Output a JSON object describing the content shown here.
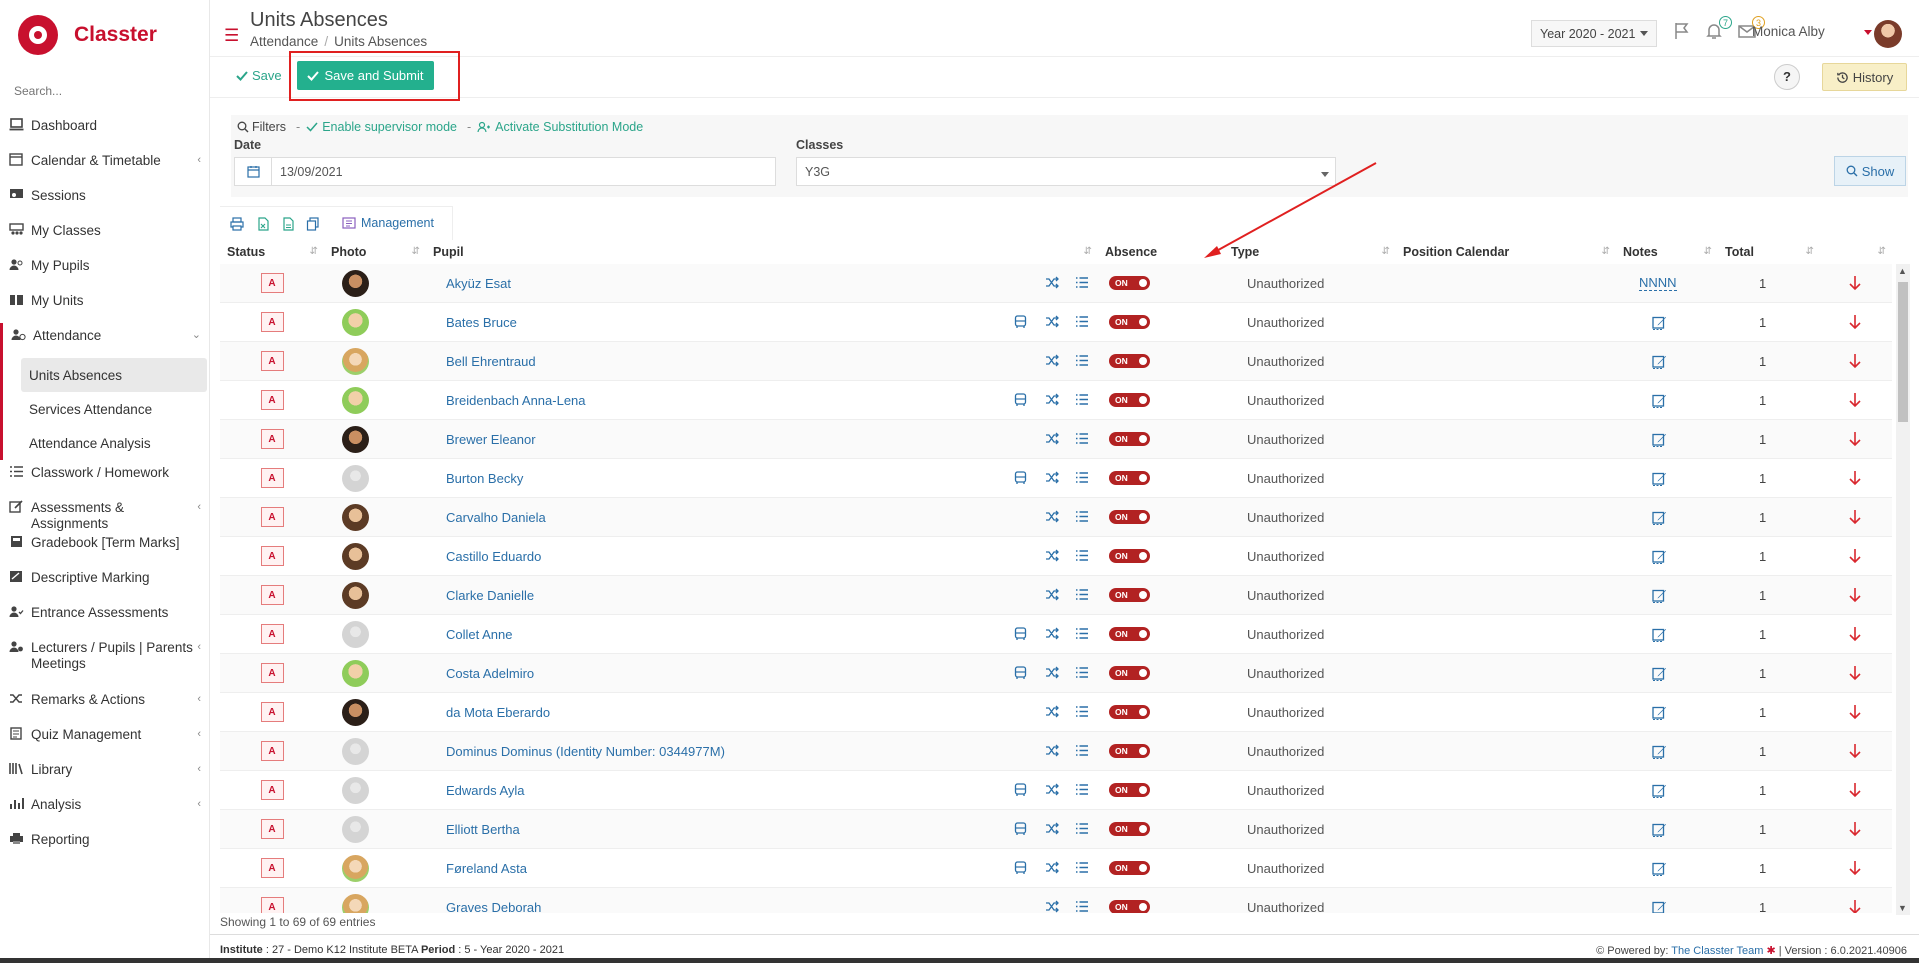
{
  "app": {
    "name": "Classter"
  },
  "sidebar": {
    "search_placeholder": "Search...",
    "items": [
      {
        "label": "Dashboard",
        "icon": "laptop-icon"
      },
      {
        "label": "Calendar & Timetable",
        "icon": "calendar-icon",
        "chevron": "‹"
      },
      {
        "label": "Sessions",
        "icon": "sessions-icon"
      },
      {
        "label": "My Classes",
        "icon": "classes-icon"
      },
      {
        "label": "My Pupils",
        "icon": "pupils-icon"
      },
      {
        "label": "My Units",
        "icon": "book-icon"
      },
      {
        "label": "Attendance",
        "icon": "attendance-icon",
        "chevron": "⌄"
      }
    ],
    "attendance_sub": [
      "Units Absences",
      "Services Attendance",
      "Attendance Analysis"
    ],
    "items2": [
      {
        "label": "Classwork / Homework",
        "icon": "list-icon"
      },
      {
        "label": "Assessments & Assignments",
        "icon": "edit-icon",
        "chevron": "‹"
      },
      {
        "label": "Gradebook [Term Marks]",
        "icon": "gradebook-icon"
      },
      {
        "label": "Descriptive Marking",
        "icon": "marking-icon"
      },
      {
        "label": "Entrance Assessments",
        "icon": "user-check-icon"
      },
      {
        "label": "Lecturers / Pupils | Parents Meetings",
        "icon": "meetings-icon",
        "chevron": "‹"
      },
      {
        "label": "Remarks & Actions",
        "icon": "shuffle-icon",
        "chevron": "‹"
      },
      {
        "label": "Quiz Management",
        "icon": "quiz-icon",
        "chevron": "‹"
      },
      {
        "label": "Library",
        "icon": "library-icon",
        "chevron": "‹"
      },
      {
        "label": "Analysis",
        "icon": "chart-icon",
        "chevron": "‹"
      },
      {
        "label": "Reporting",
        "icon": "printer-icon"
      }
    ]
  },
  "header": {
    "title": "Units Absences",
    "breadcrumb": [
      "Attendance",
      "Units Absences"
    ],
    "year": "Year 2020 - 2021",
    "notifications_count": "7",
    "messages_count": "3",
    "user_name": "Monica Alby"
  },
  "toolbar": {
    "save_label": "Save",
    "submit_label": "Save and Submit",
    "help_label": "?",
    "history_label": "History"
  },
  "filters": {
    "filters_label": "Filters",
    "supervisor_label": "Enable supervisor mode",
    "substitution_label": "Activate Substitution Mode",
    "date_label": "Date",
    "date_value": "13/09/2021",
    "classes_label": "Classes",
    "classes_value": "Y3G",
    "show_label": "Show"
  },
  "export": {
    "management_label": "Management"
  },
  "table": {
    "columns": [
      "Status",
      "Photo",
      "Pupil",
      "Absence",
      "Type",
      "Position Calendar",
      "Notes",
      "Total"
    ],
    "rows": [
      {
        "status": "A",
        "avatar": "av-a",
        "name": "Akyüz Esat",
        "bus": false,
        "absence": "ON",
        "type": "Unauthorized",
        "notes": "NNNN",
        "total": "1"
      },
      {
        "status": "A",
        "avatar": "av-b",
        "name": "Bates Bruce",
        "bus": true,
        "absence": "ON",
        "type": "Unauthorized",
        "notes": "",
        "total": "1"
      },
      {
        "status": "A",
        "avatar": "av-c",
        "name": "Bell Ehrentraud",
        "bus": false,
        "absence": "ON",
        "type": "Unauthorized",
        "notes": "",
        "total": "1"
      },
      {
        "status": "A",
        "avatar": "av-b",
        "name": "Breidenbach Anna-Lena",
        "bus": true,
        "absence": "ON",
        "type": "Unauthorized",
        "notes": "",
        "total": "1"
      },
      {
        "status": "A",
        "avatar": "av-a",
        "name": "Brewer Eleanor",
        "bus": false,
        "absence": "ON",
        "type": "Unauthorized",
        "notes": "",
        "total": "1"
      },
      {
        "status": "A",
        "avatar": "av-e",
        "name": "Burton Becky",
        "bus": true,
        "absence": "ON",
        "type": "Unauthorized",
        "notes": "",
        "total": "1"
      },
      {
        "status": "A",
        "avatar": "av-d",
        "name": "Carvalho Daniela",
        "bus": false,
        "absence": "ON",
        "type": "Unauthorized",
        "notes": "",
        "total": "1"
      },
      {
        "status": "A",
        "avatar": "av-d",
        "name": "Castillo Eduardo",
        "bus": false,
        "absence": "ON",
        "type": "Unauthorized",
        "notes": "",
        "total": "1"
      },
      {
        "status": "A",
        "avatar": "av-d",
        "name": "Clarke Danielle",
        "bus": false,
        "absence": "ON",
        "type": "Unauthorized",
        "notes": "",
        "total": "1"
      },
      {
        "status": "A",
        "avatar": "av-e",
        "name": "Collet Anne",
        "bus": true,
        "absence": "ON",
        "type": "Unauthorized",
        "notes": "",
        "total": "1"
      },
      {
        "status": "A",
        "avatar": "av-b",
        "name": "Costa Adelmiro",
        "bus": true,
        "absence": "ON",
        "type": "Unauthorized",
        "notes": "",
        "total": "1"
      },
      {
        "status": "A",
        "avatar": "av-a",
        "name": "da Mota Eberardo",
        "bus": false,
        "absence": "ON",
        "type": "Unauthorized",
        "notes": "",
        "total": "1"
      },
      {
        "status": "A",
        "avatar": "av-e",
        "name": "Dominus Dominus (Identity Number: 0344977M)",
        "bus": false,
        "absence": "ON",
        "type": "Unauthorized",
        "notes": "",
        "total": "1"
      },
      {
        "status": "A",
        "avatar": "av-e",
        "name": "Edwards Ayla",
        "bus": true,
        "absence": "ON",
        "type": "Unauthorized",
        "notes": "",
        "total": "1"
      },
      {
        "status": "A",
        "avatar": "av-e",
        "name": "Elliott Bertha",
        "bus": true,
        "absence": "ON",
        "type": "Unauthorized",
        "notes": "",
        "total": "1"
      },
      {
        "status": "A",
        "avatar": "av-c",
        "name": "Føreland Asta",
        "bus": true,
        "absence": "ON",
        "type": "Unauthorized",
        "notes": "",
        "total": "1"
      },
      {
        "status": "A",
        "avatar": "av-c",
        "name": "Graves Deborah",
        "bus": false,
        "absence": "ON",
        "type": "Unauthorized",
        "notes": "",
        "total": "1"
      }
    ]
  },
  "showing": "Showing 1 to 69 of 69 entries",
  "footer": {
    "institute_label": "Institute",
    "institute_value": ": 27 - Demo K12 Institute BETA",
    "period_label": "Period",
    "period_value": ": 5 - Year 2020 - 2021",
    "powered_label": "Powered by:",
    "powered_team": "The Classter Team",
    "version": "| Version : 6.0.2021.40906"
  },
  "colors": {
    "brand": "#c8102e",
    "accent": "#23b08e",
    "link": "#2a6fa8",
    "annotation": "#e02020"
  }
}
